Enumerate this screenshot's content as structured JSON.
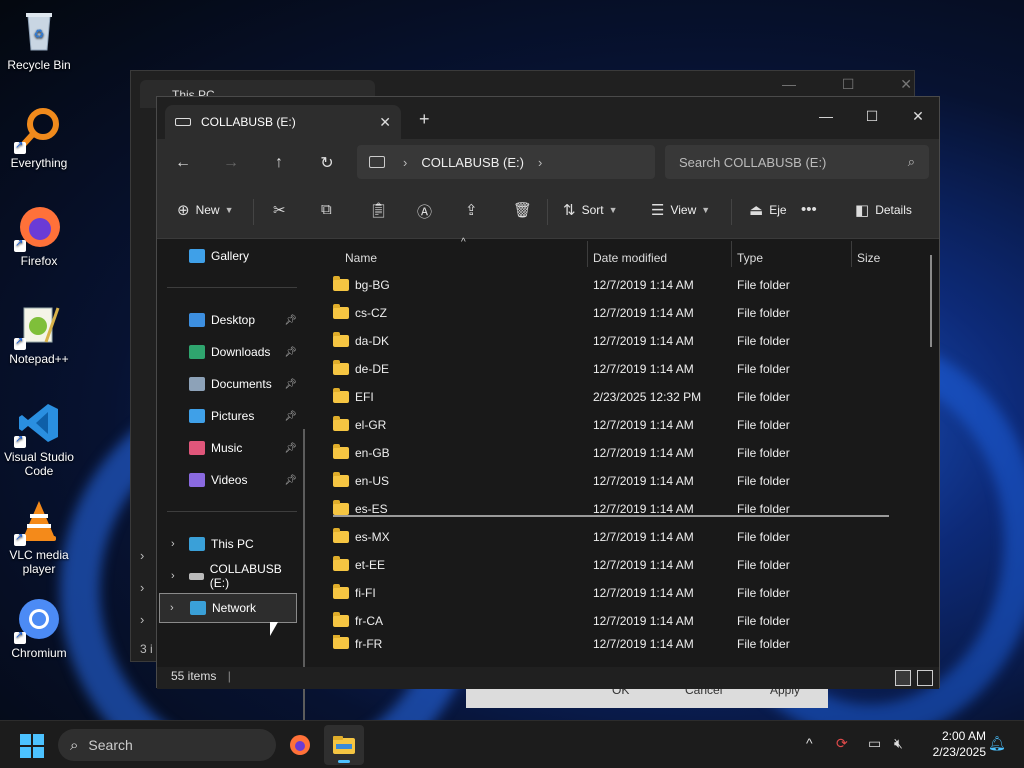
{
  "desktop": {
    "icons": [
      {
        "label": "Recycle Bin",
        "icon": "recycle-bin-icon"
      },
      {
        "label": "Everything",
        "icon": "everything-search-icon"
      },
      {
        "label": "Firefox",
        "icon": "firefox-icon"
      },
      {
        "label": "Notepad++",
        "icon": "notepadpp-icon"
      },
      {
        "label": "Visual Studio Code",
        "icon": "vscode-icon"
      },
      {
        "label": "VLC media player",
        "icon": "vlc-icon"
      },
      {
        "label": "Chromium",
        "icon": "chromium-icon"
      }
    ]
  },
  "background_window": {
    "tab_title": "This PC",
    "status_partial": "3 i",
    "dialog_buttons": [
      "OK",
      "Cancel",
      "Apply"
    ]
  },
  "explorer": {
    "tab_title": "COLLABUSB (E:)",
    "path_crumb": "COLLABUSB (E:)",
    "search_placeholder": "Search COLLABUSB (E:)",
    "commands": {
      "new": "New",
      "sort": "Sort",
      "view": "View",
      "eject": "Eje",
      "details": "Details"
    },
    "nav": {
      "gallery": "Gallery",
      "quick_access": [
        {
          "label": "Desktop",
          "icon": "desktop-icon",
          "color": "#3d8fe0"
        },
        {
          "label": "Downloads",
          "icon": "downloads-icon",
          "color": "#2fa56e"
        },
        {
          "label": "Documents",
          "icon": "documents-icon",
          "color": "#8da2b8"
        },
        {
          "label": "Pictures",
          "icon": "pictures-icon",
          "color": "#3fa0e8"
        },
        {
          "label": "Music",
          "icon": "music-icon",
          "color": "#e0567a"
        },
        {
          "label": "Videos",
          "icon": "videos-icon",
          "color": "#8a6ae0"
        }
      ],
      "this_pc": "This PC",
      "drive": "COLLABUSB (E:)",
      "network": "Network"
    },
    "columns": {
      "name": "Name",
      "date": "Date modified",
      "type": "Type",
      "size": "Size"
    },
    "files": [
      {
        "name": "bg-BG",
        "date": "12/7/2019 1:14 AM",
        "type": "File folder"
      },
      {
        "name": "cs-CZ",
        "date": "12/7/2019 1:14 AM",
        "type": "File folder"
      },
      {
        "name": "da-DK",
        "date": "12/7/2019 1:14 AM",
        "type": "File folder"
      },
      {
        "name": "de-DE",
        "date": "12/7/2019 1:14 AM",
        "type": "File folder"
      },
      {
        "name": "EFI",
        "date": "2/23/2025 12:32 PM",
        "type": "File folder"
      },
      {
        "name": "el-GR",
        "date": "12/7/2019 1:14 AM",
        "type": "File folder"
      },
      {
        "name": "en-GB",
        "date": "12/7/2019 1:14 AM",
        "type": "File folder"
      },
      {
        "name": "en-US",
        "date": "12/7/2019 1:14 AM",
        "type": "File folder"
      },
      {
        "name": "es-ES",
        "date": "12/7/2019 1:14 AM",
        "type": "File folder"
      },
      {
        "name": "es-MX",
        "date": "12/7/2019 1:14 AM",
        "type": "File folder"
      },
      {
        "name": "et-EE",
        "date": "12/7/2019 1:14 AM",
        "type": "File folder"
      },
      {
        "name": "fi-FI",
        "date": "12/7/2019 1:14 AM",
        "type": "File folder"
      },
      {
        "name": "fr-CA",
        "date": "12/7/2019 1:14 AM",
        "type": "File folder"
      },
      {
        "name": "fr-FR",
        "date": "12/7/2019 1:14 AM",
        "type": "File folder"
      }
    ],
    "status": "55 items"
  },
  "taskbar": {
    "search_label": "Search",
    "time": "2:00 AM",
    "date": "2/23/2025",
    "accent": "#4cc2ff"
  }
}
